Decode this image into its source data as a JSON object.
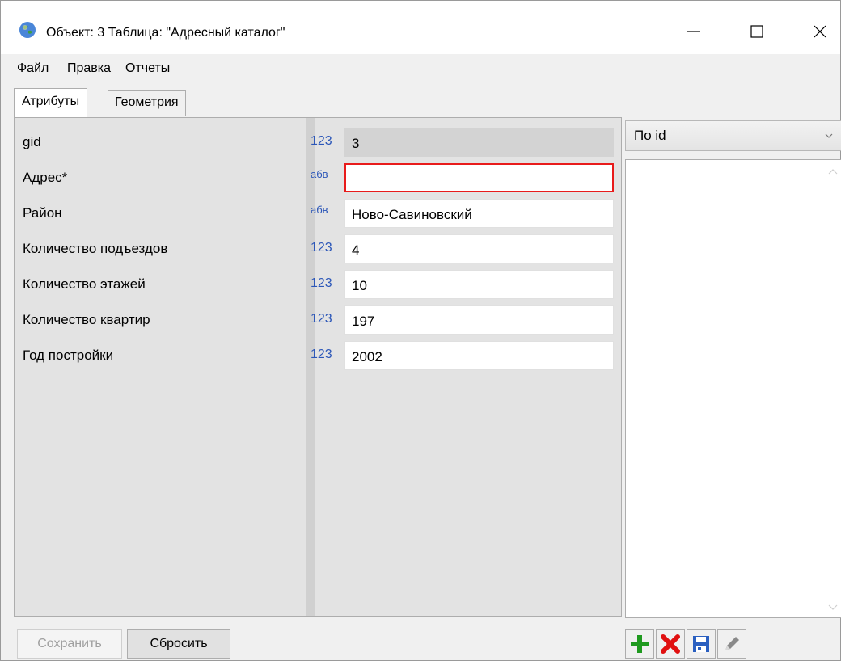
{
  "window": {
    "title": "Объект: 3 Таблица: \"Адресный каталог\""
  },
  "menu": [
    "Файл",
    "Правка",
    "Отчеты"
  ],
  "tabs": [
    {
      "label": "Атрибуты",
      "active": true
    },
    {
      "label": "Геометрия",
      "active": false
    }
  ],
  "attributes": [
    {
      "label": "gid",
      "type": "123",
      "value": "3",
      "readonly": true
    },
    {
      "label": "Адрес*",
      "type": "абв",
      "value": "",
      "required": true
    },
    {
      "label": "Район",
      "type": "абв",
      "value": "Ново-Савиновский"
    },
    {
      "label": "Количество подъездов",
      "type": "123",
      "value": "4"
    },
    {
      "label": "Количество этажей",
      "type": "123",
      "value": "10"
    },
    {
      "label": "Количество квартир",
      "type": "123",
      "value": "197"
    },
    {
      "label": "Год постройки",
      "type": "123",
      "value": "2002"
    }
  ],
  "sort_dropdown": {
    "selected": "По id"
  },
  "buttons": {
    "save": "Сохранить",
    "reset": "Сбросить"
  },
  "icons": {
    "app": "globe-icon",
    "add": "plus-icon",
    "delete": "x-icon",
    "save": "floppy-icon",
    "edit": "pencil-icon"
  },
  "colors": {
    "type_badge": "#2b56b8",
    "required_border": "#e81b1b",
    "add": "#1f9a1f",
    "delete": "#e01010",
    "floppy": "#2a5fc0"
  }
}
